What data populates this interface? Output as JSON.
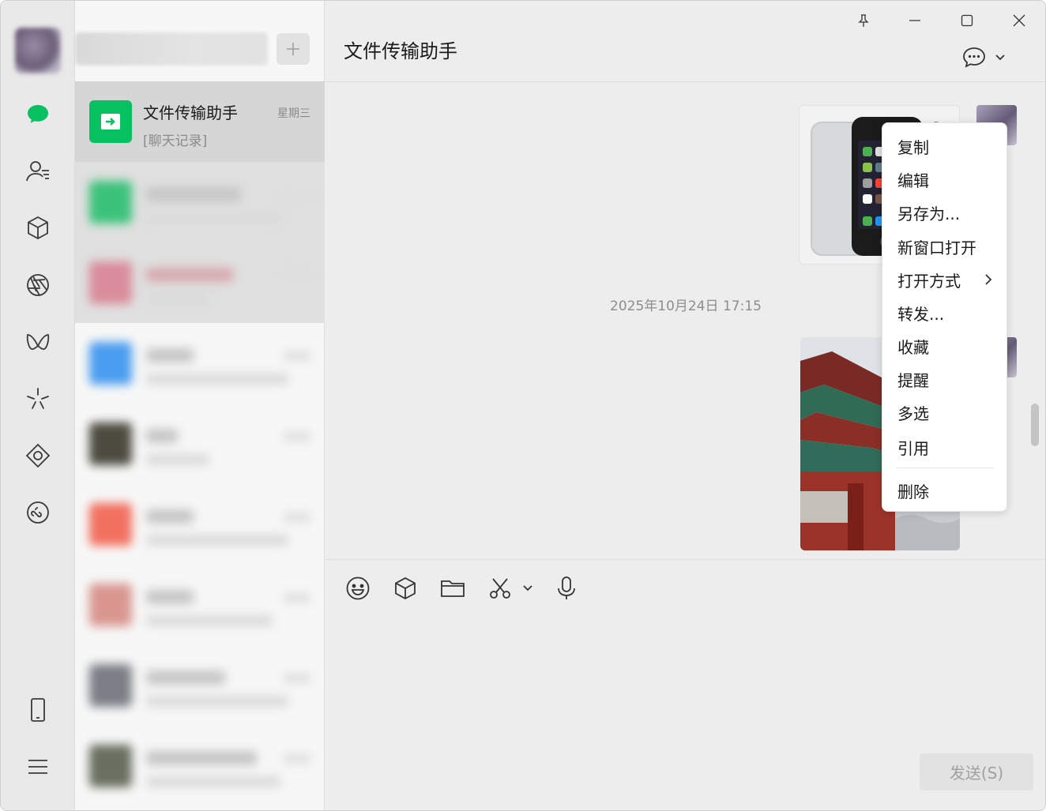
{
  "app": {
    "chat_title": "文件传输助手",
    "window_controls": [
      "pin-icon",
      "minimize-icon",
      "maximize-icon",
      "close-icon"
    ]
  },
  "rail": {
    "icons": [
      "chat-icon",
      "contacts-icon",
      "cube-icon",
      "moments-icon",
      "channels-icon",
      "spark-icon",
      "diamond-icon",
      "miniprogram-icon",
      "phone-icon",
      "menu-icon"
    ],
    "accent": "#07c160"
  },
  "conversations": [
    {
      "name": "文件传输助手",
      "time": "星期三",
      "preview": "[聊天记录]"
    }
  ],
  "chat": {
    "timestamp": "2025年10月24日 17:15",
    "send_label": "发送(S)"
  },
  "toolbar": {
    "icons": [
      "emoji-icon",
      "cube-icon",
      "folder-icon",
      "scissors-icon",
      "chevron-down-icon",
      "microphone-icon"
    ]
  },
  "context_menu": {
    "items": [
      "复制",
      "编辑",
      "另存为...",
      "新窗口打开",
      "打开方式",
      "转发...",
      "收藏",
      "提醒",
      "多选",
      "引用",
      "删除"
    ]
  }
}
